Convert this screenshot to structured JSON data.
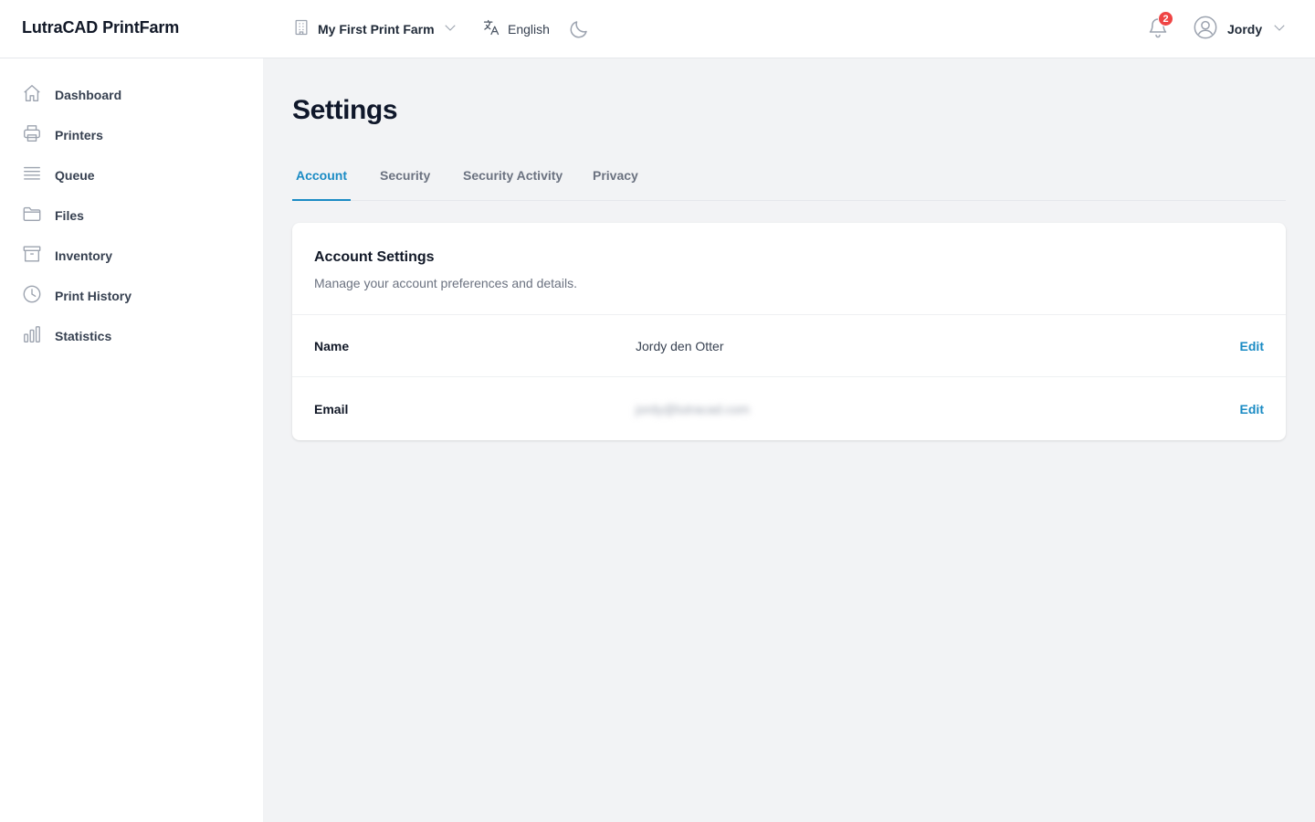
{
  "app": {
    "title": "LutraCAD PrintFarm"
  },
  "topbar": {
    "farm": {
      "label": "My First Print Farm",
      "icon": "building-icon"
    },
    "language": {
      "label": "English",
      "icon": "translate-icon"
    },
    "theme": {
      "icon": "moon-icon"
    },
    "notifications": {
      "count": "2",
      "icon": "bell-icon"
    },
    "user": {
      "label": "Jordy",
      "icon": "user-circle-icon"
    }
  },
  "sidebar": {
    "items": [
      {
        "label": "Dashboard",
        "icon": "home-icon"
      },
      {
        "label": "Printers",
        "icon": "printer-icon"
      },
      {
        "label": "Queue",
        "icon": "queue-icon"
      },
      {
        "label": "Files",
        "icon": "folder-icon"
      },
      {
        "label": "Inventory",
        "icon": "archive-icon"
      },
      {
        "label": "Print History",
        "icon": "clock-icon"
      },
      {
        "label": "Statistics",
        "icon": "bar-chart-icon"
      }
    ]
  },
  "main": {
    "title": "Settings",
    "tabs": [
      {
        "label": "Account",
        "active": true
      },
      {
        "label": "Security",
        "active": false
      },
      {
        "label": "Security Activity",
        "active": false
      },
      {
        "label": "Privacy",
        "active": false
      }
    ],
    "card": {
      "title": "Account Settings",
      "subtitle": "Manage your account preferences and details.",
      "rows": [
        {
          "label": "Name",
          "value": "Jordy den Otter",
          "action": "Edit"
        },
        {
          "label": "Email",
          "value": "jordy@lutracad.com",
          "action": "Edit",
          "blurred": true
        }
      ]
    }
  },
  "colors": {
    "accent": "#1a8bc4",
    "badge": "#ef4444",
    "background": "#f2f3f5"
  }
}
